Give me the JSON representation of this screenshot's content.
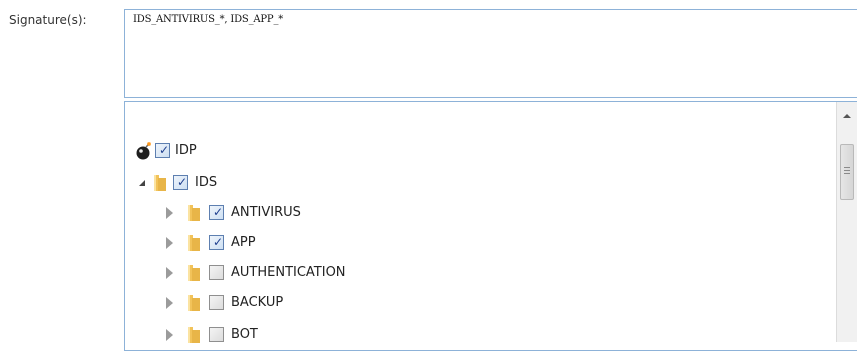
{
  "signatures": {
    "label": "Signature(s):",
    "value": "IDS_ANTIVIRUS_*, IDS_APP_*"
  },
  "tree": {
    "root": {
      "label": "IDP",
      "checked": true,
      "icon": "idp-bomb-icon"
    },
    "ids": {
      "label": "IDS",
      "checked": true,
      "expanded": true,
      "icon": "folder-icon"
    },
    "children": [
      {
        "label": "ANTIVIRUS",
        "checked": true,
        "icon": "folder-icon"
      },
      {
        "label": "APP",
        "checked": true,
        "icon": "folder-icon"
      },
      {
        "label": "AUTHENTICATION",
        "checked": false,
        "icon": "folder-icon"
      },
      {
        "label": "BACKUP",
        "checked": false,
        "icon": "folder-icon"
      },
      {
        "label": "BOT",
        "checked": false,
        "icon": "folder-icon"
      }
    ]
  },
  "colors": {
    "border": "#8db2d8",
    "folder": "#e8b548",
    "check": "#1f3f8f"
  }
}
